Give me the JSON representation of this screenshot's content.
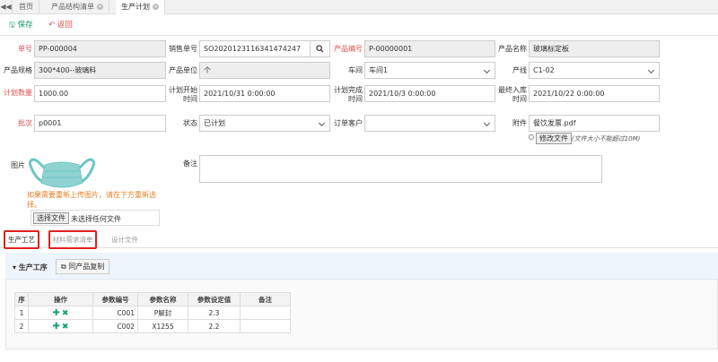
{
  "tabs": [
    {
      "label": "首页",
      "closable": false
    },
    {
      "label": "产品结构清单",
      "closable": true
    },
    {
      "label": "生产计划",
      "closable": true,
      "active": true
    }
  ],
  "toolbar": {
    "save_label": "保存",
    "back_label": "返回"
  },
  "form": {
    "order_no": {
      "label": "单号",
      "value": "PP-000004"
    },
    "sales_no": {
      "label": "销售单号",
      "value": "SO2020123116341474247"
    },
    "product_no": {
      "label": "产品编号",
      "value": "P-00000001"
    },
    "product_name": {
      "label": "产品名称",
      "value": "玻璃标定板"
    },
    "spec": {
      "label": "产品规格",
      "value": "300*400--玻璃料"
    },
    "unit": {
      "label": "产品单位",
      "value": "个"
    },
    "workshop": {
      "label": "车间",
      "value": "车间1"
    },
    "line": {
      "label": "产线",
      "value": "C1-02"
    },
    "qty": {
      "label": "计划数量",
      "value": "1000.00"
    },
    "start": {
      "label1": "计划开始",
      "label2": "时间",
      "value": "2021/10/31 0:00:00"
    },
    "finish": {
      "label1": "计划完成",
      "label2": "时间",
      "value": "2021/10/3 0:00:00"
    },
    "latest": {
      "label1": "最终入库",
      "label2": "时间",
      "value": "2021/10/22 0:00:00"
    },
    "batch": {
      "label": "批次",
      "value": "p0001"
    },
    "status": {
      "label": "状态",
      "value": "已计划"
    },
    "customer": {
      "label": "订单客户",
      "value": ""
    },
    "attach": {
      "label": "附件",
      "value": "餐饮发票.pdf",
      "modify_btn": "修改文件",
      "limit": "(文件大小不能超过10M)"
    },
    "image": {
      "label": "图片",
      "hint1": "如果需要重新上传图片，请在下方重新选",
      "hint2": "择。",
      "choose_btn": "选择文件",
      "no_file": "未选择任何文件"
    },
    "remark": {
      "label": "备注",
      "value": ""
    }
  },
  "subtabs": [
    "生产工艺",
    "材料需求清单",
    "设计文件"
  ],
  "process": {
    "title": "生产工序",
    "copy_btn": "同产品复制",
    "columns": [
      "序",
      "操作",
      "参数编号",
      "参数名称",
      "参数设定值",
      "备注"
    ],
    "rows": [
      {
        "idx": "1",
        "code": "C001",
        "name": "P解封",
        "value": "2.3",
        "note": ""
      },
      {
        "idx": "2",
        "code": "C002",
        "name": "X1255",
        "value": "2.2",
        "note": ""
      }
    ]
  },
  "colors": {
    "accent": "#1a9a6a",
    "required": "#d9534f",
    "highlight": "#e0201b"
  }
}
